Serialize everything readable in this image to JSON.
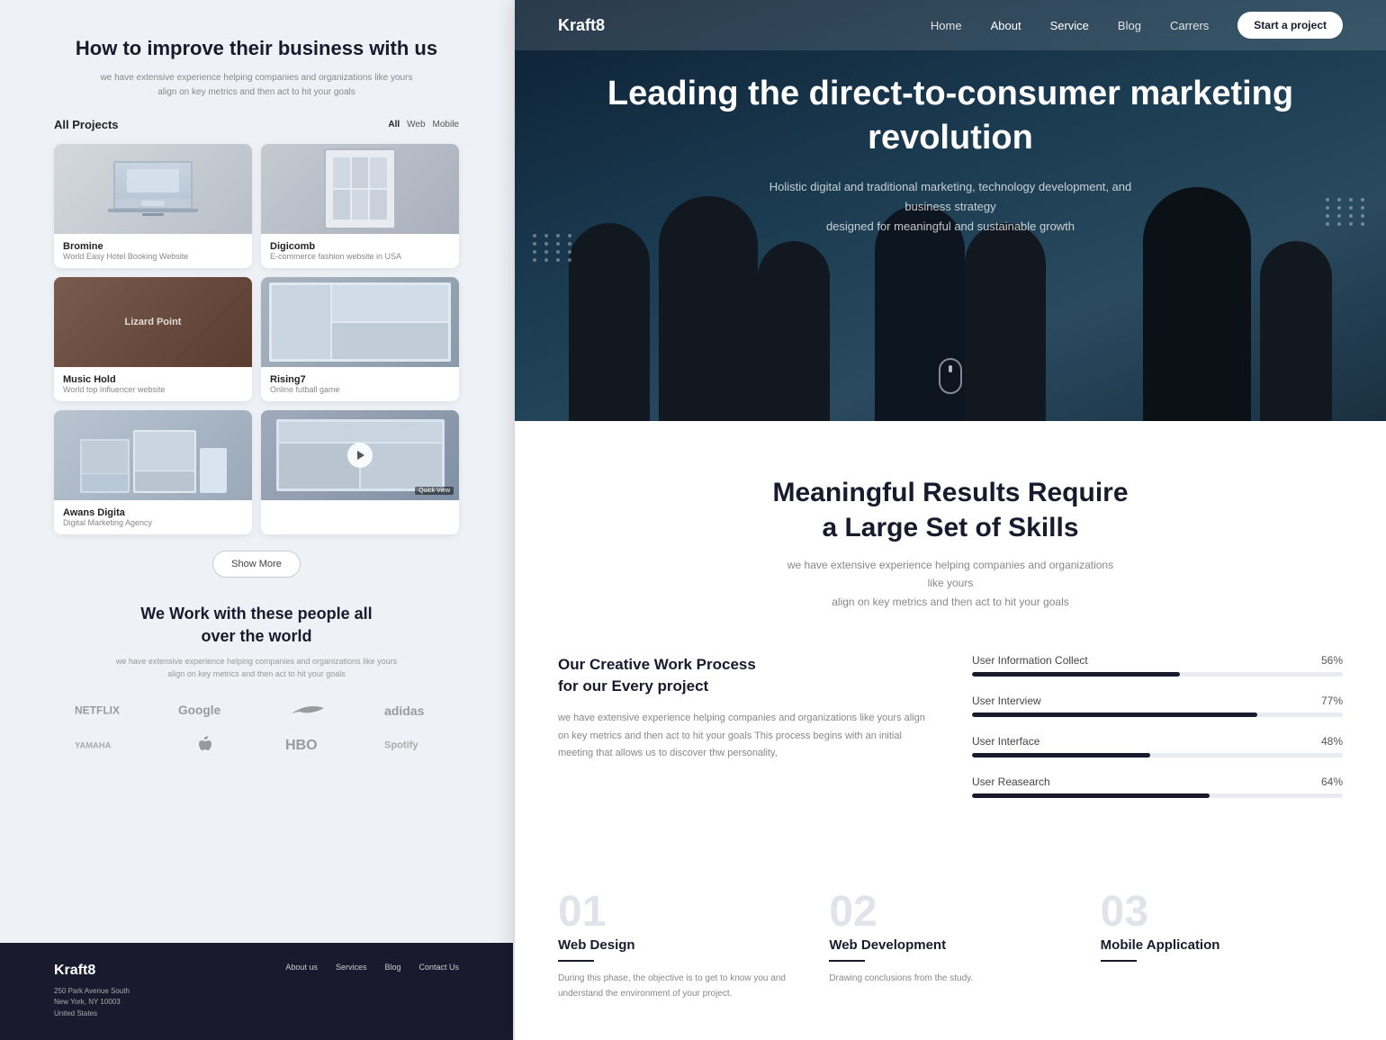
{
  "left": {
    "hero_title": "How to improve their business with us",
    "hero_sub": "we have extensive experience helping companies and organizations like yours\nalign on key metrics and then act to hit your goals",
    "projects_title": "All Projects",
    "filter_all": "All",
    "filter_web": "Web",
    "filter_mobile": "Mobile",
    "projects": [
      {
        "id": "bromine",
        "name": "Bromine",
        "desc": "World Easy Hotel Booking Website",
        "img_type": "bromine"
      },
      {
        "id": "digicomb",
        "name": "Digicomb",
        "desc": "E-commerce fashion website in USA",
        "img_type": "digicomb"
      },
      {
        "id": "musichold",
        "name": "Music Hold",
        "desc": "World top Influencer website",
        "img_type": "musichold"
      },
      {
        "id": "rising7",
        "name": "Rising7",
        "desc": "Online futball game",
        "img_type": "rising7"
      },
      {
        "id": "awans",
        "name": "Awans Digita",
        "desc": "Digital Marketing Agency",
        "img_type": "awans"
      },
      {
        "id": "quickview",
        "name": "Quick View",
        "desc": "",
        "img_type": "quickview"
      }
    ],
    "show_more_label": "Show More",
    "partners_title": "We Work with these people all over the world",
    "partners_sub": "we have extensive experience helping companies and organizations like yours\nalign on key metrics and then act to hit your goals",
    "partners": [
      "NETFLIX",
      "Google",
      "Nike",
      "Adidas",
      "Yamaha",
      "Apple",
      "HBO",
      "Spotify"
    ],
    "footer": {
      "brand": "Kraft8",
      "address": "250 Park Avenue South\nNew York, NY 10003\nUnited States",
      "links": [
        "About us",
        "Services",
        "Blog",
        "Contact Us"
      ]
    }
  },
  "right": {
    "navbar": {
      "brand": "Kraft8",
      "links": [
        {
          "id": "home",
          "label": "Home"
        },
        {
          "id": "about",
          "label": "About"
        },
        {
          "id": "service",
          "label": "Service"
        },
        {
          "id": "blog",
          "label": "Blog"
        },
        {
          "id": "careers",
          "label": "Carrers"
        }
      ],
      "cta_label": "Start a project"
    },
    "hero": {
      "title": "Leading the direct-to-consumer marketing revolution",
      "subtitle": "Holistic digital and traditional marketing, technology development, and business strategy\ndesigned for meaningful and sustainable growth"
    },
    "skills_section": {
      "title": "Meaningful Results Require\na Large Set of Skills",
      "subtitle": "we have extensive experience helping companies and organizations like yours\nalign on key metrics and then act to hit your goals",
      "process_title": "Our Creative Work Process\nfor our Every project",
      "process_desc": "we have extensive experience helping companies and organizations like yours align on key metrics and then act to hit your goals This process begins with an initial meeting that allows us to discover thw personality,",
      "skills": [
        {
          "id": "user-info",
          "label": "User Information Collect",
          "pct": 56
        },
        {
          "id": "user-interview",
          "label": "User Interview",
          "pct": 77
        },
        {
          "id": "user-interface",
          "label": "User Interface",
          "pct": 48
        },
        {
          "id": "user-research",
          "label": "User Reasearch",
          "pct": 64
        }
      ]
    },
    "services": [
      {
        "id": "web-design",
        "number": "01",
        "name": "Web Design",
        "desc": "During this phase, the objective is to get to know you and understand the environment of your project."
      },
      {
        "id": "web-dev",
        "number": "02",
        "name": "Web Development",
        "desc": "Drawing conclusions from the study."
      },
      {
        "id": "mobile-app",
        "number": "03",
        "name": "Mobile Application",
        "desc": ""
      }
    ]
  }
}
